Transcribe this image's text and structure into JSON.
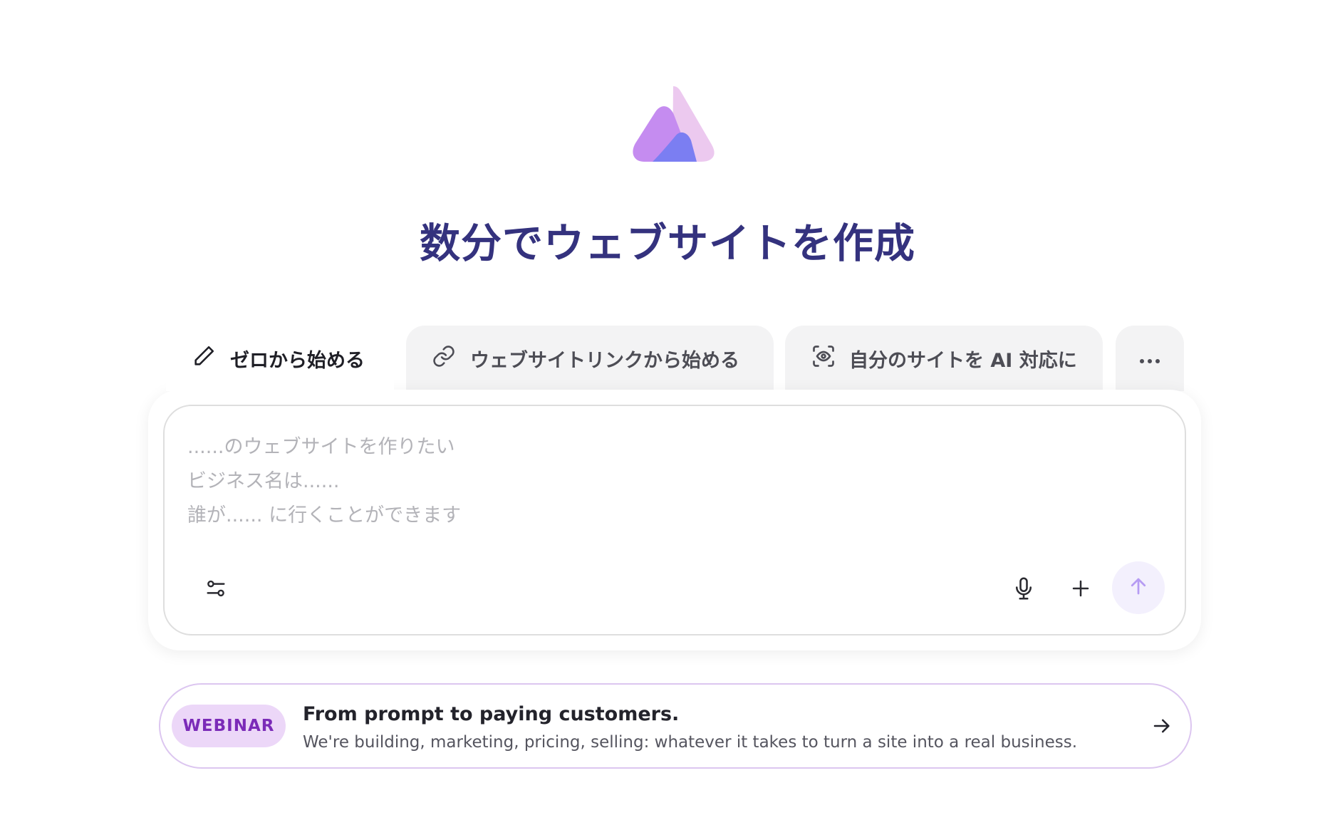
{
  "headline": "数分でウェブサイトを作成",
  "tabs": [
    {
      "label": "ゼロから始める",
      "icon": "pencil-icon",
      "active": true
    },
    {
      "label": "ウェブサイトリンクから始める",
      "icon": "link-icon",
      "active": false
    },
    {
      "label": "自分のサイトを AI 対応に",
      "icon": "scan-eye-icon",
      "active": false
    },
    {
      "label": "",
      "icon": "more-horizontal-icon",
      "active": false
    }
  ],
  "composer": {
    "placeholder": "......のウェブサイトを作りたい\nビジネス名は......\n誰が...... に行くことができます",
    "settings_icon": "sliders-icon",
    "mic_icon": "microphone-icon",
    "add_icon": "plus-icon",
    "send_icon": "arrow-up-icon"
  },
  "banner": {
    "badge": "WEBINAR",
    "title": "From prompt to paying customers.",
    "subtitle": "We're building, marketing, pricing, selling: whatever it takes to turn a site into a real business.",
    "arrow_icon": "arrow-right-icon"
  },
  "colors": {
    "headline": "#34327e",
    "accent_purple": "#c58cf0",
    "accent_blue": "#7b7ef2",
    "badge_bg": "#ecd7f8",
    "badge_text": "#7b2bb8",
    "send_bg": "#f3f0fd"
  }
}
